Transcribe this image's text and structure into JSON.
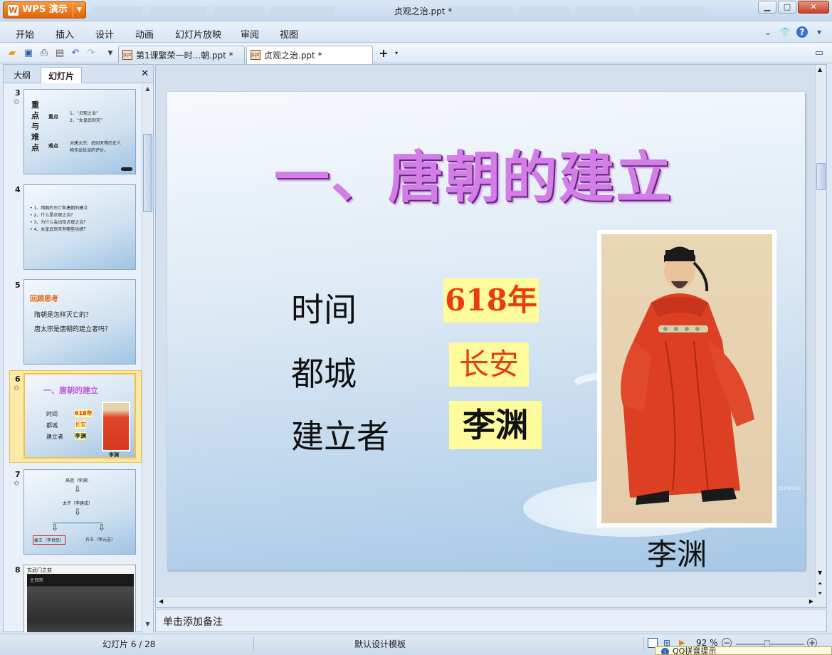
{
  "window": {
    "app_button": "WPS 演示",
    "title": "贞观之治.ppt *"
  },
  "menu": {
    "items": [
      "开始",
      "插入",
      "设计",
      "动画",
      "幻灯片放映",
      "审阅",
      "视图"
    ]
  },
  "tabs": [
    {
      "label": "第1课繁荣一时...朝.ppt *",
      "active": false
    },
    {
      "label": "贞观之治.ppt *",
      "active": true
    }
  ],
  "panel": {
    "tabs": [
      "大纲",
      "幻灯片"
    ],
    "active_tab": "幻灯片"
  },
  "thumbnails": {
    "t3": {
      "num": "3",
      "big": [
        "重",
        "点",
        "与",
        "难",
        "点"
      ],
      "k1": "重点",
      "v1a": "1、“贞观之治”",
      "v1b": "2、“女皇武则天”",
      "k2": "难点",
      "v2a": "对唐太宗、武则天等历史人",
      "v2b": "物作出恰当的评价。"
    },
    "t4": {
      "num": "4",
      "lines": [
        "• 1、隋朝的灭亡和唐朝的建立",
        "• 2、什么是贞观之治？",
        "• 3、为什么会出现贞观之治？",
        "• 4、女皇武则天有哪些功绩？"
      ]
    },
    "t5": {
      "num": "5",
      "tag": "回顾思考",
      "q1": "隋朝是怎样灭亡的？",
      "q2": "唐太宗是唐朝的建立者吗？"
    },
    "t6": {
      "num": "6",
      "title": "一、唐朝的建立",
      "r1": "时间",
      "v1": "618年",
      "r2": "都城",
      "v2": "长安",
      "r3": "建立者",
      "v3": "李渊",
      "cap": "李渊"
    },
    "t7": {
      "num": "7",
      "top": "高祖（李渊）",
      "mid": "太子（李建成）",
      "left": "秦王（李世民）",
      "right": "齐王（李元吉）"
    },
    "t8": {
      "num": "8",
      "title": "玄武门之变",
      "sub": "主页网"
    }
  },
  "slide": {
    "title": "一、唐朝的建立",
    "rows": [
      {
        "label": "时间",
        "value": "618年"
      },
      {
        "label": "都城",
        "value": "长安"
      },
      {
        "label": "建立者",
        "value": "李渊"
      }
    ],
    "caption": "李渊",
    "watermark": "purpose"
  },
  "notes": {
    "placeholder": "单击添加备注"
  },
  "status": {
    "slide_pos": "幻灯片 6 / 28",
    "template": "默认设计模板",
    "zoom": "92 %"
  },
  "popup": {
    "text": "QQ拼音提示"
  }
}
